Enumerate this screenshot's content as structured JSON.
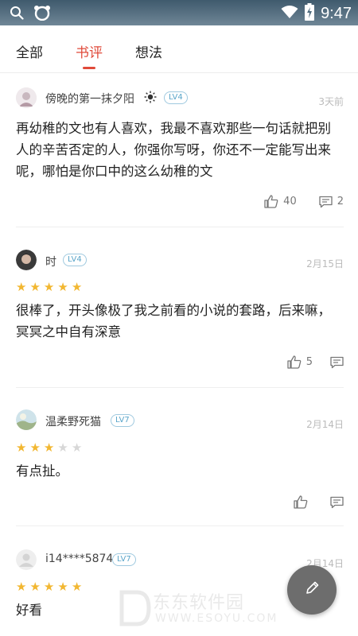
{
  "status_bar": {
    "time": "9:47"
  },
  "tabs": [
    {
      "label": "全部"
    },
    {
      "label": "书评"
    },
    {
      "label": "想法"
    }
  ],
  "active_tab": "书评",
  "posts": [
    {
      "user": "傍晚的第一抹夕阳",
      "level": "LV4",
      "date": "3天前",
      "stars": null,
      "content": "再幼稚的文也有人喜欢，我最不喜欢那些一句话就把别人的辛苦否定的人，你强你写呀，你还不一定能写出来呢，哪怕是你口中的这么幼稚的文",
      "likes": "40",
      "comments": "2"
    },
    {
      "user": "时",
      "level": "LV4",
      "date": "2月15日",
      "stars": 5,
      "content": "很棒了，开头像极了我之前看的小说的套路，后来嘛，冥冥之中自有深意",
      "likes": "5",
      "comments": ""
    },
    {
      "user": "温柔野死猫",
      "level": "LV7",
      "date": "2月14日",
      "stars": 3,
      "content": "有点扯。",
      "likes": "",
      "comments": ""
    },
    {
      "user": "i14****5874",
      "level": "LV7",
      "date": "2月14日",
      "stars": 5,
      "content": "好看",
      "likes": "",
      "comments": ""
    }
  ],
  "watermark": {
    "text": "东东软件园",
    "sub": "WWW.ESOYU.COM"
  },
  "colors": {
    "accent": "#e04a3a",
    "star": "#f2b731",
    "level_badge": "#5aa5c9"
  }
}
